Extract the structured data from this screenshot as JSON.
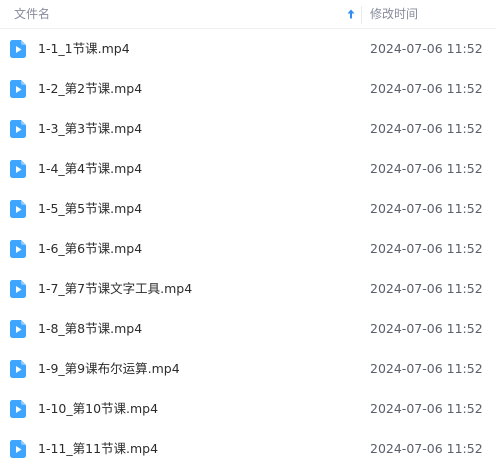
{
  "header": {
    "name_label": "文件名",
    "time_label": "修改时间",
    "sort_icon": "arrow-up-icon",
    "sort_color": "#2f8cf5"
  },
  "file_icon": {
    "name": "video-file-icon",
    "color": "#3ea6ff"
  },
  "files": [
    {
      "name": "1-1_1节课.mp4",
      "modified": "2024-07-06 11:52"
    },
    {
      "name": "1-2_第2节课.mp4",
      "modified": "2024-07-06 11:52"
    },
    {
      "name": "1-3_第3节课.mp4",
      "modified": "2024-07-06 11:52"
    },
    {
      "name": "1-4_第4节课.mp4",
      "modified": "2024-07-06 11:52"
    },
    {
      "name": "1-5_第5节课.mp4",
      "modified": "2024-07-06 11:52"
    },
    {
      "name": "1-6_第6节课.mp4",
      "modified": "2024-07-06 11:52"
    },
    {
      "name": "1-7_第7节课文字工具.mp4",
      "modified": "2024-07-06 11:52"
    },
    {
      "name": "1-8_第8节课.mp4",
      "modified": "2024-07-06 11:52"
    },
    {
      "name": "1-9_第9课布尔运算.mp4",
      "modified": "2024-07-06 11:52"
    },
    {
      "name": "1-10_第10节课.mp4",
      "modified": "2024-07-06 11:52"
    },
    {
      "name": "1-11_第11节课.mp4",
      "modified": "2024-07-06 11:52"
    }
  ]
}
